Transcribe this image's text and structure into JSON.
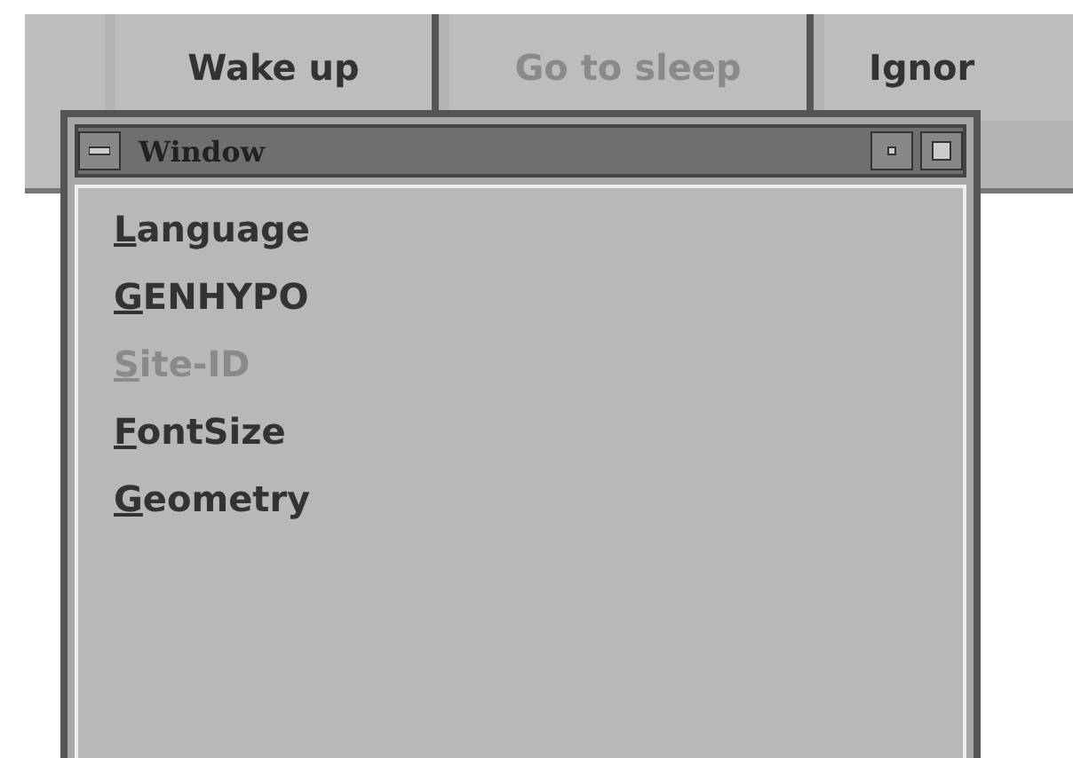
{
  "buttons": [
    {
      "label": "Wake up",
      "disabled": false
    },
    {
      "label": "Go to sleep",
      "disabled": true
    },
    {
      "label": "Ignor",
      "disabled": false
    }
  ],
  "window": {
    "title": "Window"
  },
  "menu": [
    {
      "label": "Language",
      "disabled": false
    },
    {
      "label": "GENHYPO",
      "disabled": false
    },
    {
      "label": "Site-ID",
      "disabled": true
    },
    {
      "label": "FontSize",
      "disabled": false
    },
    {
      "label": "Geometry",
      "disabled": false
    }
  ]
}
